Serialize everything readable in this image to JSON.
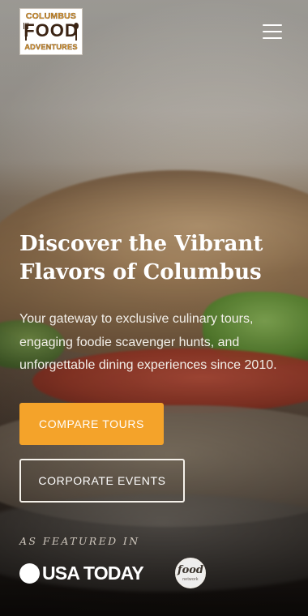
{
  "header": {
    "logo": {
      "line1": "COLUMBUS",
      "line2": "FOOD",
      "line3": "ADVENTURES"
    },
    "menu_icon": "hamburger-icon"
  },
  "hero": {
    "title": "Discover the Vibrant Flavors of Columbus",
    "subtitle": "Your gateway to exclusive culinary tours, engaging foodie scavenger hunts, and unforgettable dining experiences since 2010.",
    "primary_button": "COMPARE TOURS",
    "secondary_button": "CORPORATE EVENTS"
  },
  "featured": {
    "label": "AS FEATURED IN",
    "usa_today": "USA TODAY",
    "food_network": {
      "top": "food",
      "bottom": "network"
    }
  },
  "colors": {
    "accent": "#f4a32a",
    "text": "#ffffff",
    "logo_orange": "#e09a2c",
    "logo_brown": "#3b2414"
  }
}
